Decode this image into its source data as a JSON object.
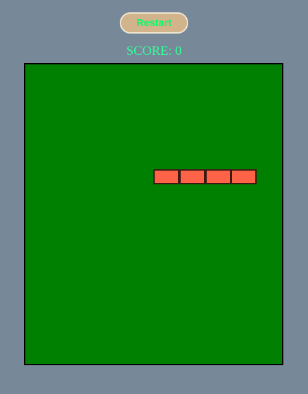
{
  "controls": {
    "restart_label": "Restart"
  },
  "score": {
    "label": "SCORE:",
    "value": "0"
  },
  "board": {
    "background": "#008000",
    "border": "#000000"
  },
  "snake": {
    "color": "#ff6347",
    "length": 4
  },
  "colors": {
    "page_background": "#778899",
    "button_background": "#d2b48c",
    "button_text": "#00ff66",
    "score_text": "#33ff99"
  }
}
